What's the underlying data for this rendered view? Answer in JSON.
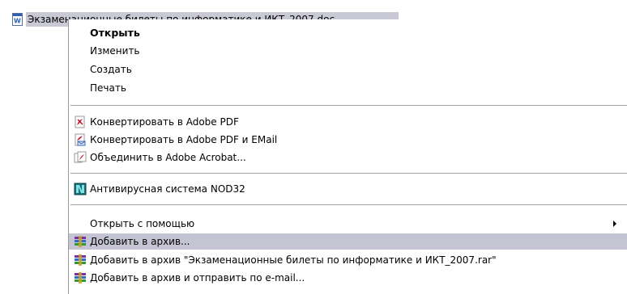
{
  "file": {
    "name": "Экзаменационные билеты по информатике и ИКТ_2007.doc"
  },
  "menu": {
    "items": [
      {
        "label": "Открыть",
        "icon": "none"
      },
      {
        "label": "Изменить",
        "icon": "none"
      },
      {
        "label": "Создать",
        "icon": "none"
      },
      {
        "label": "Печать",
        "icon": "none"
      },
      {
        "label": "Конвертировать в Adobe PDF",
        "icon": "pdf-icon"
      },
      {
        "label": "Конвертировать в Adobe PDF и EMail",
        "icon": "pdf-email-icon"
      },
      {
        "label": "Объединить в Adobe Acrobat...",
        "icon": "acrobat-icon"
      },
      {
        "label": "Антивирусная система NOD32",
        "icon": "nod32-icon"
      },
      {
        "label": "Открыть с помощью",
        "icon": "none"
      },
      {
        "label": "Добавить в архив...",
        "icon": "winrar-icon"
      },
      {
        "label": "Добавить в архив \"Экзаменационные билеты по информатике и ИКТ_2007.rar\"",
        "icon": "winrar-icon"
      },
      {
        "label": "Добавить в архив и отправить по e-mail...",
        "icon": "winrar-icon"
      }
    ]
  },
  "colors": {
    "highlight": "#c4c4d2",
    "selection": "#c9c9d6",
    "pdf_red": "#c8102e"
  }
}
